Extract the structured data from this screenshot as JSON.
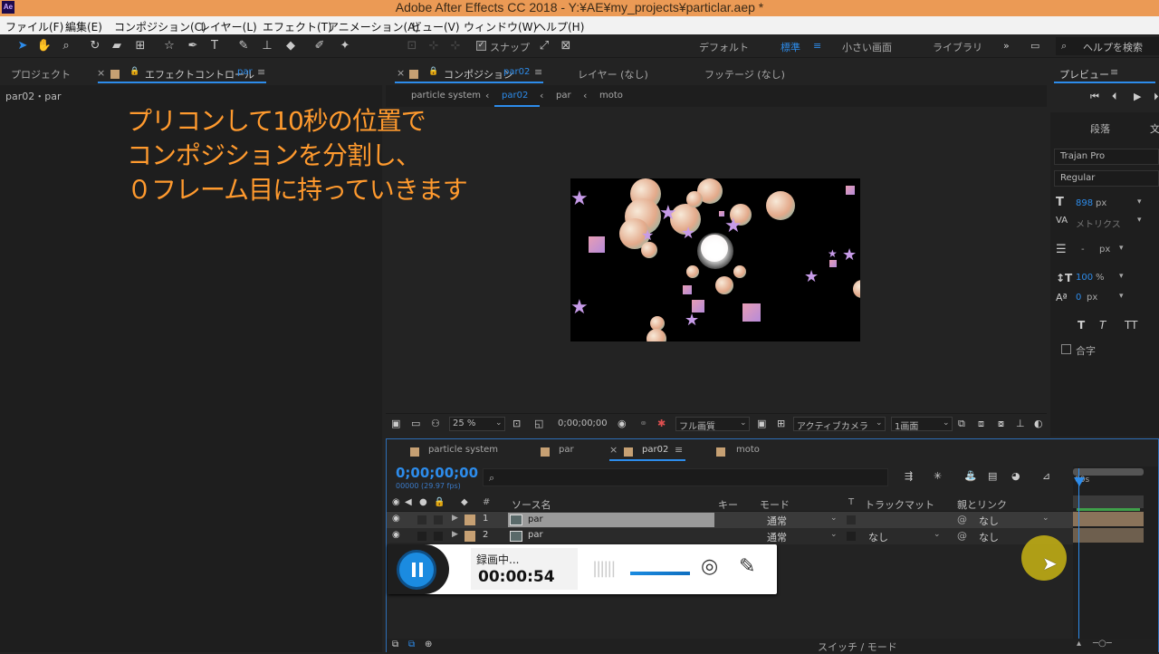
{
  "app": {
    "icon_text": "Ae",
    "title": "Adobe After Effects CC 2018 - Y:¥AE¥my_projects¥particlar.aep *"
  },
  "menu": [
    "ファイル(F)",
    "編集(E)",
    "コンポジション(C)",
    "レイヤー(L)",
    "エフェクト(T)",
    "アニメーション(A)",
    "ビュー(V)",
    "ウィンドウ(W)",
    "ヘルプ(H)"
  ],
  "toolbar": {
    "snap_label": "スナップ",
    "workspaces": [
      "デフォルト",
      "標準",
      "小さい画面",
      "ライブラリ"
    ],
    "active_workspace": "標準",
    "help_search": "ヘルプを検索"
  },
  "left_panel": {
    "tab_project": "プロジェクト",
    "tab_effects": "エフェクトコントロール",
    "tab_effects_target": "par",
    "breadcrumb": "par02・par"
  },
  "overlay_text": "プリコンして10秒の位置で\nコンポジションを分割し、\n０フレーム目に持っていきます",
  "comp_panel": {
    "tab_comp": "コンポジション",
    "tab_comp_name": "par02",
    "tab_layer": "レイヤー (なし)",
    "tab_footage": "フッテージ (なし)",
    "breadcrumbs": [
      "particle system",
      "par02",
      "par",
      "moto"
    ],
    "footer": {
      "zoom": "25 %",
      "timecode": "0;00;00;00",
      "resolution": "フル画質",
      "camera": "アクティブカメラ",
      "views": "1画面"
    }
  },
  "right_panel": {
    "preview_title": "プレビュー",
    "tab_paragraph": "段落",
    "tab_character": "文",
    "font": "Trajan Pro",
    "style": "Regular",
    "size": "898",
    "size_unit": "px",
    "tracking_label": "メトリクス",
    "leading": "-",
    "leading_unit": "px",
    "vscale": "100",
    "vscale_unit": "%",
    "baseline": "0",
    "baseline_unit": "px",
    "ligature_label": "合字"
  },
  "timeline": {
    "tabs": [
      "particle system",
      "par",
      "par02",
      "moto"
    ],
    "active_tab": "par02",
    "timecode": "0;00;00;00",
    "fps": "00000 (29.97 fps)",
    "search_placeholder": "",
    "columns": {
      "num": "#",
      "source": "ソース名",
      "key": "キー",
      "mode": "モード",
      "t": "T",
      "trkmat": "トラックマット",
      "parent": "親とリンク"
    },
    "layers": [
      {
        "num": "1",
        "name": "par",
        "mode": "通常",
        "trkmat": "",
        "parent": "なし"
      },
      {
        "num": "2",
        "name": "par",
        "mode": "通常",
        "trkmat": "なし",
        "parent": "なし"
      }
    ],
    "ruler_label": "00s",
    "switch_mode": "スイッチ / モード"
  },
  "recorder": {
    "status": "録画中...",
    "time": "00:00:54"
  },
  "colors": {
    "title_bar": "#eb9a55",
    "accent": "#2d8ceb",
    "overlay_text": "#ff9a2e",
    "label_swatch": "#c6a073",
    "record_button": "#1b8be0"
  }
}
